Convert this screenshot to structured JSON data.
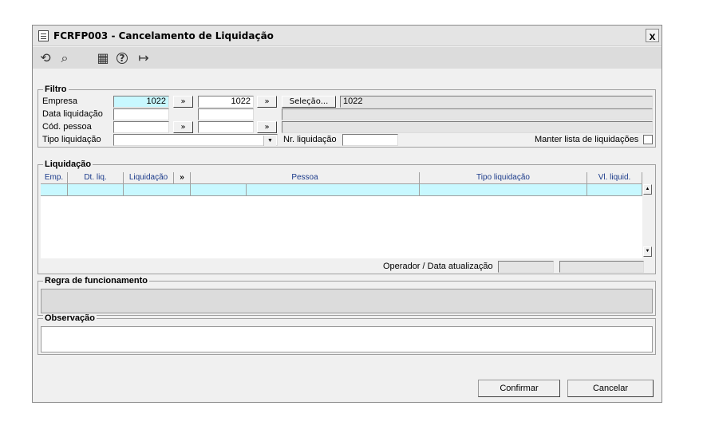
{
  "window": {
    "title": "FCRFP003 - Cancelamento de Liquidação",
    "close_label": "x"
  },
  "toolbar": {
    "icons": [
      "undo-icon",
      "search-icon",
      "calendar-icon",
      "help-icon",
      "exit-icon"
    ],
    "glyphs": {
      "undo": "⟲",
      "search": "⌕",
      "calendar": "▦",
      "help": "?",
      "exit": "↦"
    }
  },
  "filtro": {
    "legend": "Filtro",
    "empresa_label": "Empresa",
    "empresa_from": "1022",
    "empresa_to": "1022",
    "range_button": "»",
    "selecao_button": "Seleção...",
    "selecao_value": "1022",
    "data_label": "Data liquidação",
    "pessoa_label": "Cód. pessoa",
    "tipo_label": "Tipo liquidação",
    "nr_label": "Nr. liquidação",
    "manter_label": "Manter lista de liquidações"
  },
  "liquidacao": {
    "legend": "Liquidação",
    "columns": [
      "Emp.",
      "Dt. liq.",
      "Liquidação",
      "»",
      "Pessoa",
      "Tipo liquidação",
      "Vl. liquid."
    ],
    "operador_label": "Operador / Data atualização"
  },
  "regra": {
    "legend": "Regra de funcionamento"
  },
  "observacao": {
    "legend": "Observação"
  },
  "buttons": {
    "confirmar": "Confirmar",
    "cancelar": "Cancelar"
  }
}
